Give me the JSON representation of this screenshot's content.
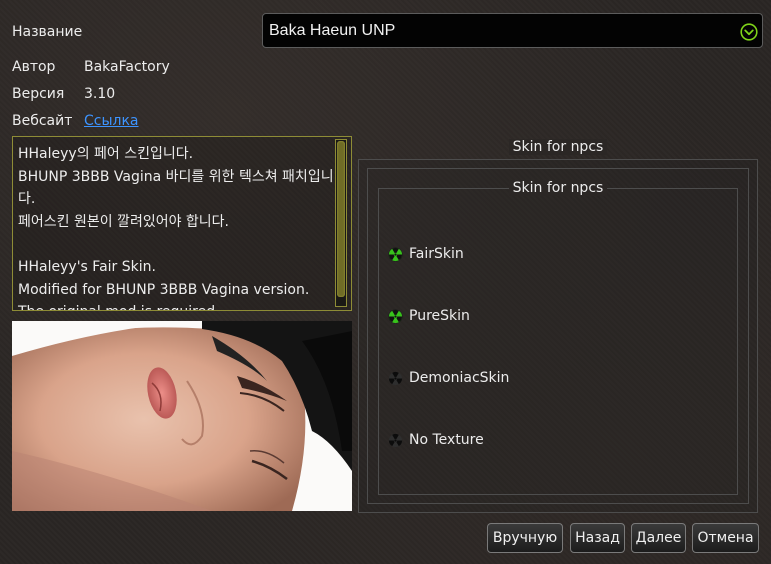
{
  "info": {
    "name_label": "Название",
    "author_label": "Автор",
    "author_value": "BakaFactory",
    "version_label": "Версия",
    "version_value": "3.10",
    "website_label": "Вебсайт",
    "website_link": "Ссылка"
  },
  "title_combo": {
    "value": "Baka Haeun UNP",
    "icon": "chevron-down-circle-icon",
    "accent": "#7fd319"
  },
  "description": {
    "text": "HHaleyy의 페어 스킨입니다.\nBHUNP 3BBB Vagina 바디를 위한 텍스쳐 패치입니다.\n페어스킨 원본이 깔려있어야 합니다.\n\nHHaleyy's Fair Skin.\nModified for BHUNP 3BBB Vagina version.\nThe original mod is required."
  },
  "options_group": {
    "title": "Skin for npcs",
    "inner_title": "Skin for npcs",
    "options": [
      {
        "label": "FairSkin",
        "icon": "radiation-icon",
        "state": "enabled",
        "color": "#38c21c"
      },
      {
        "label": "PureSkin",
        "icon": "radiation-icon",
        "state": "enabled",
        "color": "#38c21c"
      },
      {
        "label": "DemoniacSkin",
        "icon": "radiation-icon",
        "state": "disabled",
        "color": "#4a4a4a"
      },
      {
        "label": "No Texture",
        "icon": "radiation-icon",
        "state": "disabled",
        "color": "#4a4a4a"
      }
    ]
  },
  "buttons": {
    "manual": "Вручную",
    "back": "Назад",
    "next": "Далее",
    "cancel": "Отмена"
  },
  "colors": {
    "description_border": "#8e8c36",
    "link": "#3d94ff"
  }
}
